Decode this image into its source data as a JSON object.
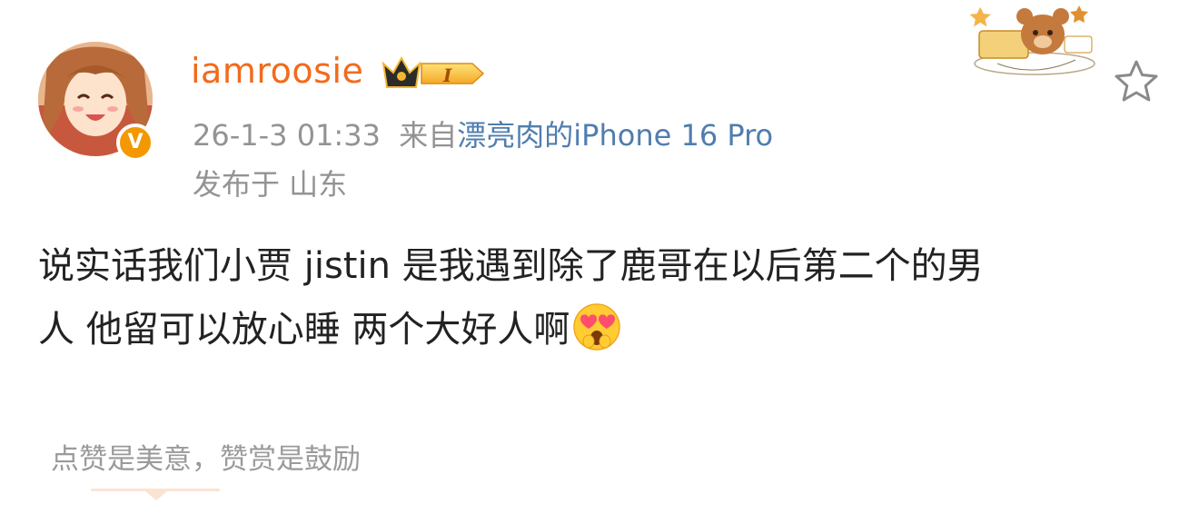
{
  "post": {
    "username": "iamroosie",
    "member_level": "I",
    "timestamp": "26-1-3 01:33",
    "source_prefix": "来自",
    "source_device": "漂亮肉的iPhone 16 Pro",
    "location_line": "发布于 山东",
    "body_line1": "说实话我们小贾 jistin 是我遇到除了鹿哥在以后第二个的男",
    "body_line2": "人 他留可以放心睡 两个大好人啊",
    "emoji": "heart-eyes-emoji"
  },
  "badges": {
    "verified_mark": "V",
    "verified_color": "#f39800",
    "crown_icon": "crown-icon"
  },
  "actions": {
    "favorite_icon": "star-outline-icon"
  },
  "footer": {
    "reward_text": "点赞是美意，赞赏是鼓励"
  },
  "colors": {
    "username": "#f26b1d",
    "source_link": "#507daf",
    "meta": "#939393",
    "body": "#222222"
  }
}
